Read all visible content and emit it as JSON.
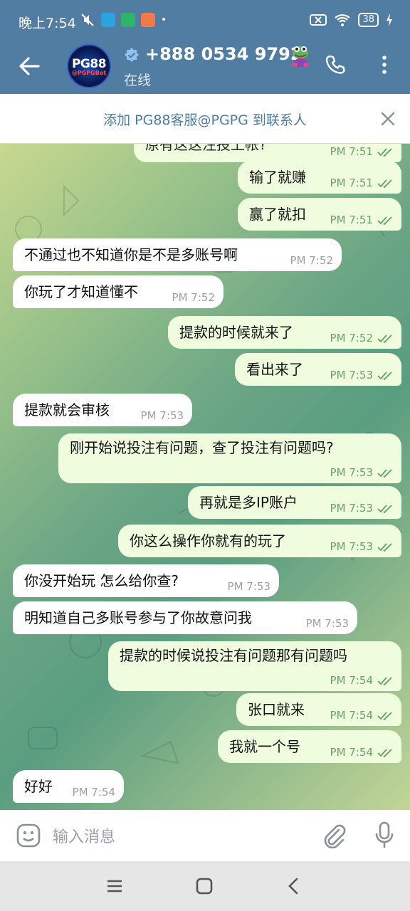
{
  "status_bar": {
    "time": "晚上7:54",
    "battery": "38"
  },
  "header": {
    "avatar_text": "PG88",
    "avatar_subtext": "@PGPGBot",
    "title": "+888 0534 9792",
    "subtitle": "在线"
  },
  "add_contact": {
    "text": "添加 PG88客服@PGPG 到联系人"
  },
  "messages": [
    {
      "text": "原有这这注投上帐?",
      "time": "PM 7:51",
      "dir": "out",
      "partial": true
    },
    {
      "text": "输了就赚",
      "time": "PM 7:51",
      "dir": "out"
    },
    {
      "text": "赢了就扣",
      "time": "PM 7:51",
      "dir": "out"
    },
    {
      "text": "不通过也不知道你是不是多账号啊",
      "time": "PM 7:52",
      "dir": "in"
    },
    {
      "text": "你玩了才知道懂不",
      "time": "PM 7:52",
      "dir": "in"
    },
    {
      "text": "提款的时候就来了",
      "time": "PM 7:52",
      "dir": "out"
    },
    {
      "text": "看出来了",
      "time": "PM 7:53",
      "dir": "out"
    },
    {
      "text": "提款就会审核",
      "time": "PM 7:53",
      "dir": "in"
    },
    {
      "text": "刚开始说投注有问题，查了投注有问题吗?",
      "time": "PM 7:53",
      "dir": "out",
      "two_line": true
    },
    {
      "text": "再就是多IP账户",
      "time": "PM 7:53",
      "dir": "out"
    },
    {
      "text": "你这么操作你就有的玩了",
      "time": "PM 7:53",
      "dir": "out"
    },
    {
      "text": "你没开始玩 怎么给你查?",
      "time": "PM 7:53",
      "dir": "in"
    },
    {
      "text": "明知道自己多账号参与了你故意问我",
      "time": "PM 7:53",
      "dir": "in"
    },
    {
      "text": "提款的时候说投注有问题那有问题吗",
      "time": "PM 7:54",
      "dir": "out",
      "two_line": true
    },
    {
      "text": "张口就来",
      "time": "PM 7:54",
      "dir": "out"
    },
    {
      "text": "我就一个号",
      "time": "PM 7:54",
      "dir": "out"
    },
    {
      "text": "好好",
      "time": "PM 7:54",
      "dir": "in"
    }
  ],
  "input": {
    "placeholder": "输入消息"
  },
  "colors": {
    "header": "#517da2",
    "outgoing_bubble": "#effdde",
    "incoming_bubble": "#ffffff",
    "link": "#4a7ea6"
  },
  "icons": [
    "back-arrow-icon",
    "verified-icon",
    "frog-emoji-icon",
    "call-icon",
    "more-icon",
    "close-icon",
    "emoji-icon",
    "attach-icon",
    "mic-icon",
    "menu-icon",
    "home-icon",
    "nav-back-icon"
  ]
}
